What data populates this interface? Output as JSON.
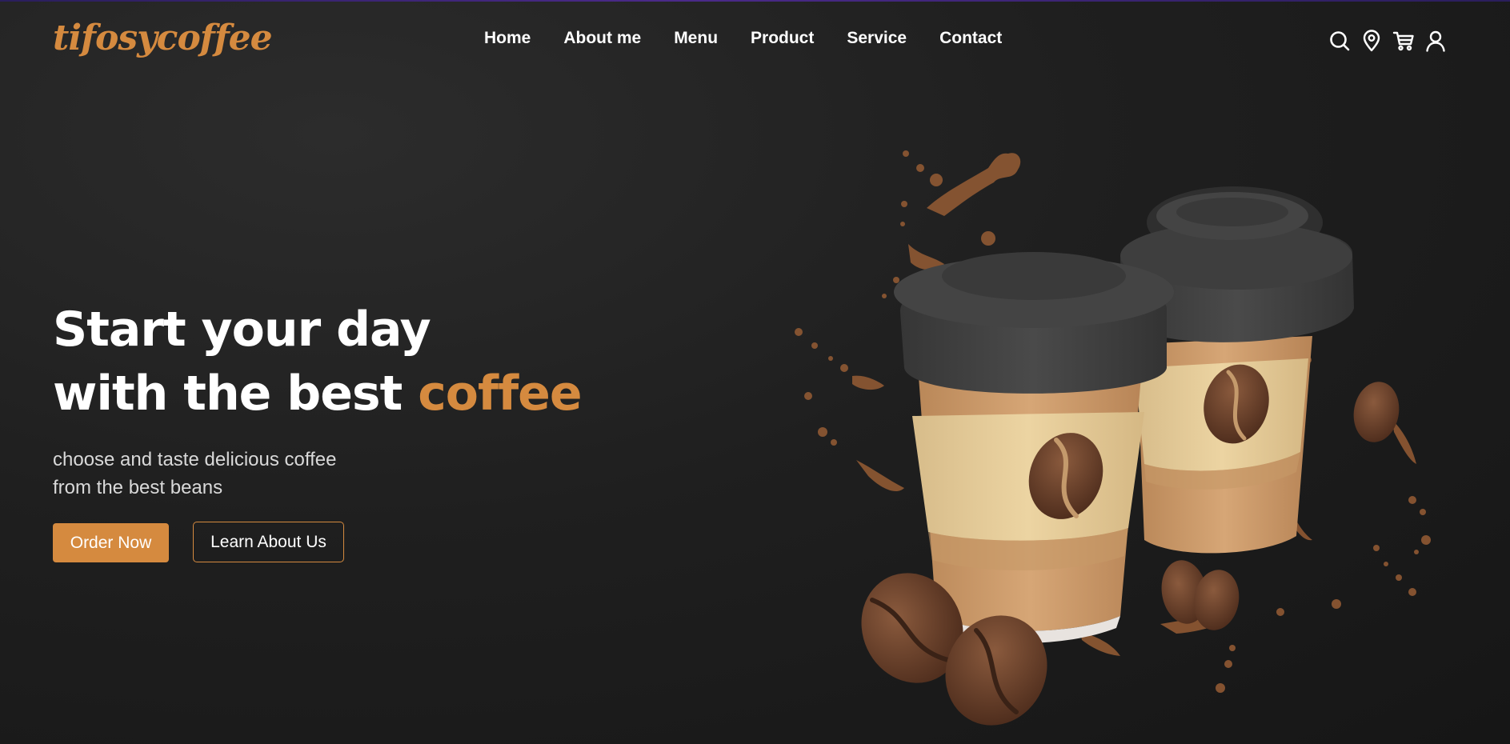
{
  "brand": {
    "logo_text": "tifosycoffee",
    "accent_color": "#d58a3f"
  },
  "nav": {
    "items": [
      "Home",
      "About me",
      "Menu",
      "Product",
      "Service",
      "Contact"
    ]
  },
  "header_icons": [
    "search-icon",
    "location-pin-icon",
    "cart-icon",
    "user-icon"
  ],
  "hero": {
    "title_line1": "Start your day",
    "title_line2_prefix": "with the best ",
    "title_line2_accent": "coffee",
    "subtitle_line1": "choose and taste delicious coffee",
    "subtitle_line2": "from the best beans",
    "primary_button": "Order Now",
    "secondary_button": "Learn About Us"
  },
  "colors": {
    "background": "#1c1c1c",
    "text": "#ffffff",
    "subtitle": "#d9d9d9"
  }
}
